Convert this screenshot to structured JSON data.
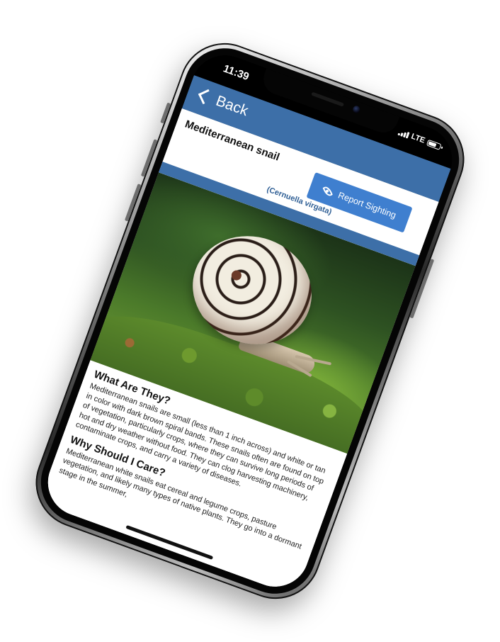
{
  "status_bar": {
    "time": "11:39",
    "network": "LTE",
    "icons": [
      "signal-icon",
      "battery-icon"
    ]
  },
  "nav": {
    "back_label": "Back",
    "back_icon": "chevron-left-icon"
  },
  "species": {
    "common_name": "Mediterranean snail",
    "scientific_name": "(Cernuella virgata)",
    "report_button_label": "Report Sighting",
    "report_button_icon": "eye-icon"
  },
  "article": {
    "section_1_heading": "What Are They?",
    "section_1_text": "Mediterranean snails are small (less than 1 inch across) and white or tan in color with dark brown spiral bands. These snails often are found on top of vegetation, particularly crops, where they can survive long periods of hot and dry weather without food. They can clog harvesting machinery, contaminate crops, and carry a variety of diseases.",
    "section_2_heading": "Why Should I Care?",
    "section_2_text": "Mediterranean white snails eat cereal and legume crops, pasture vegetation, and likely many types of native plants. They go into a dormant stage in the summer,"
  },
  "colors": {
    "nav_bar": "#3d6fa8",
    "report_button": "#3f7fcf",
    "scientific_name": "#2f5f95"
  }
}
